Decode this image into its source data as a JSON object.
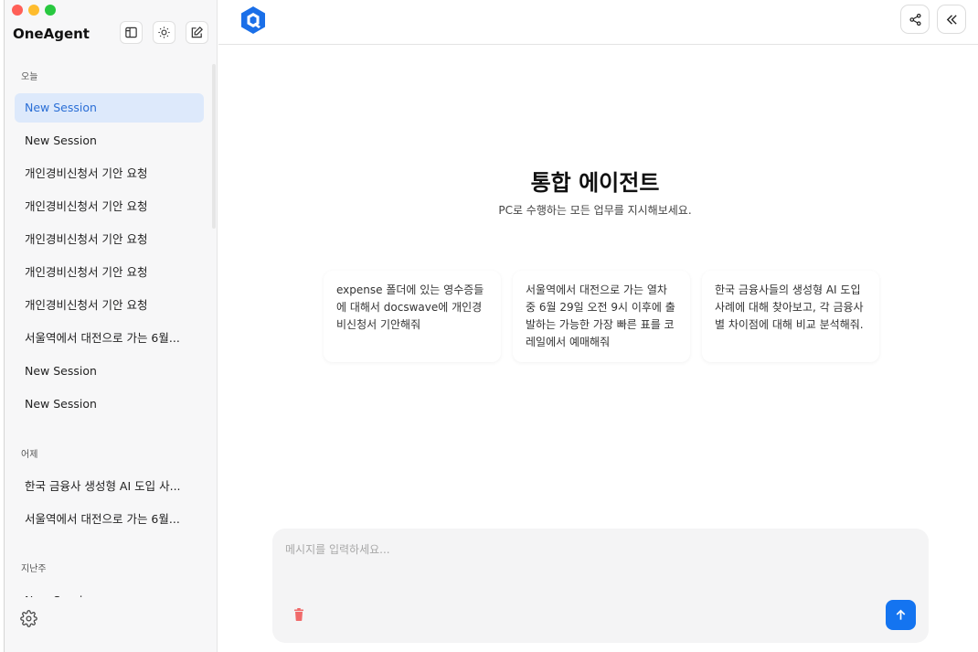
{
  "app": {
    "title": "OneAgent"
  },
  "sidebar": {
    "icons": [
      "panel-layout-icon",
      "sun-icon",
      "edit-icon"
    ],
    "groups": [
      {
        "label": "오늘",
        "items": [
          {
            "label": "New Session",
            "active": true
          },
          {
            "label": "New Session"
          },
          {
            "label": "개인경비신청서 기안 요청"
          },
          {
            "label": "개인경비신청서 기안 요청"
          },
          {
            "label": "개인경비신청서 기안 요청"
          },
          {
            "label": "개인경비신청서 기안 요청"
          },
          {
            "label": "개인경비신청서 기안 요청"
          },
          {
            "label": "서울역에서 대전으로 가는 6월..."
          },
          {
            "label": "New Session"
          },
          {
            "label": "New Session"
          }
        ]
      },
      {
        "label": "어제",
        "items": [
          {
            "label": "한국 금융사 생성형 AI 도입 사..."
          },
          {
            "label": "서울역에서 대전으로 가는 6월..."
          }
        ]
      },
      {
        "label": "지난주",
        "items": [
          {
            "label": "New Session"
          }
        ]
      }
    ],
    "settings_icon": "gear-icon"
  },
  "topbar": {
    "share_icon": "share-icon",
    "collapse_icon": "double-chevron-left-icon"
  },
  "main": {
    "title": "통합 에이전트",
    "subtitle": "PC로 수행하는 모든 업무를 지시해보세요.",
    "suggestions": [
      "expense 폴더에 있는 영수증들에 대해서 docswave에 개인경비신청서 기안해줘",
      "서울역에서 대전으로 가는 열차 중 6월 29일 오전 9시 이후에 출발하는 가능한 가장 빠른 표를 코레일에서 예매해줘",
      "한국 금융사들의 생성형 AI 도입 사례에 대해 찾아보고, 각 금융사별 차이점에 대해 비교 분석해줘."
    ]
  },
  "composer": {
    "placeholder": "메시지를 입력하세요...",
    "value": ""
  },
  "colors": {
    "accent": "#1474f0",
    "active_bg": "#dde9fb",
    "active_text": "#2b6fd6"
  }
}
